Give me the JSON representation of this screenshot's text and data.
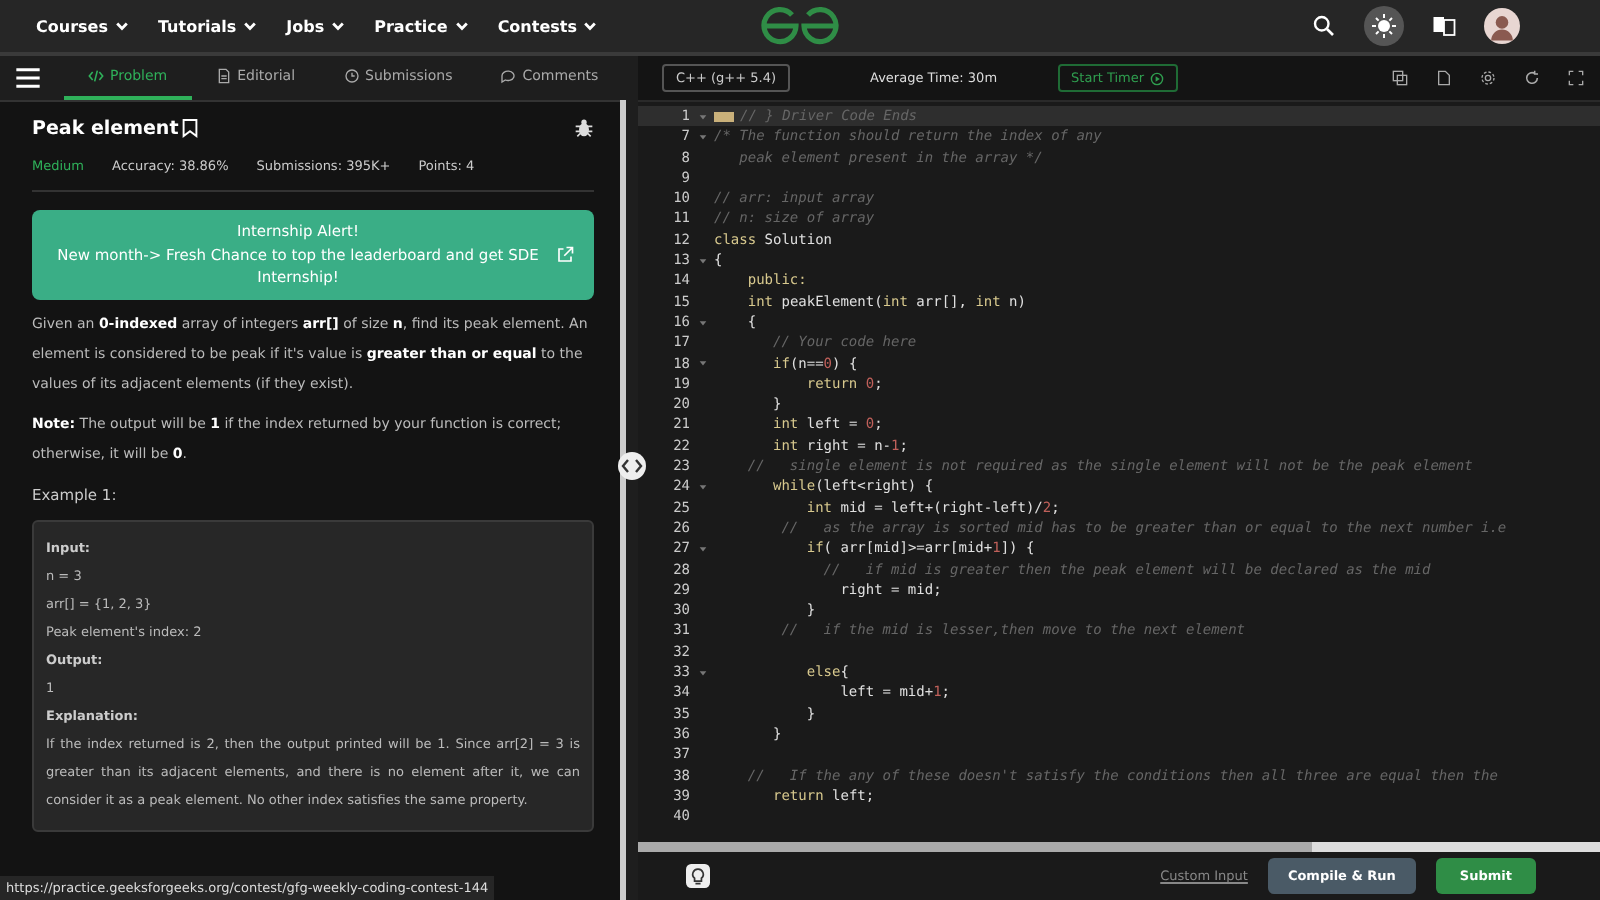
{
  "nav": {
    "menus": [
      "Courses",
      "Tutorials",
      "Jobs",
      "Practice",
      "Contests"
    ]
  },
  "tabs": [
    {
      "label": "Problem",
      "selected": true
    },
    {
      "label": "Editorial",
      "selected": false
    },
    {
      "label": "Submissions",
      "selected": false
    },
    {
      "label": "Comments",
      "selected": false
    }
  ],
  "problem": {
    "title": "Peak element",
    "difficulty": "Medium",
    "accuracy": "Accuracy: 38.86%",
    "submissions": "Submissions: 395K+",
    "points": "Points: 4",
    "alert": [
      "Internship Alert!",
      "New month-> Fresh Chance to top the leaderboard and get SDE Internship!"
    ],
    "description": "Given an **0-indexed** array of integers **arr[]** of size **n**, find its peak element. An element is considered to be peak if it's value is **greater than or equal** to the values of its adjacent elements (if they exist).",
    "note": "**Note:** The output will be **1** if the index returned by your function is correct; otherwise, it will be **0**.",
    "example_title": "Example 1:",
    "example": [
      {
        "kind": "heading",
        "text": "Input:"
      },
      {
        "kind": "text",
        "text": "n = 3"
      },
      {
        "kind": "text",
        "text": "arr[] = {1, 2, 3}"
      },
      {
        "kind": "text",
        "text": "Peak element's index: 2"
      },
      {
        "kind": "heading",
        "text": "Output:"
      },
      {
        "kind": "text",
        "text": "1"
      },
      {
        "kind": "heading",
        "text": "Explanation:"
      },
      {
        "kind": "text",
        "text": "If the index returned is 2, then the output printed will be 1. Since arr[2] = 3 is greater than its adjacent elements, and there is no element after it, we can consider it as a peak element. No other index satisfies the same property."
      }
    ]
  },
  "status_url": "https://practice.geeksforgeeks.org/contest/gfg-weekly-coding-contest-144",
  "toolbar": {
    "language": "C++ (g++ 5.4)",
    "average_time": "Average Time: 30m",
    "timer_button": "Start Timer"
  },
  "editor": {
    "lines": [
      {
        "number": "1",
        "foldable": true,
        "collapsed": true,
        "highlighted": true,
        "tokens": [
          {
            "kind": "comment",
            "text": "// } Driver Code Ends"
          }
        ]
      },
      {
        "number": "7",
        "foldable": true,
        "collapsed": false,
        "highlighted": false,
        "tokens": [
          {
            "kind": "comment",
            "text": "/* The function should return the index of any"
          }
        ]
      },
      {
        "number": "8",
        "foldable": false,
        "collapsed": false,
        "highlighted": false,
        "tokens": [
          {
            "kind": "comment",
            "text": "   peak element present in the array */"
          }
        ]
      },
      {
        "number": "9",
        "foldable": false,
        "collapsed": false,
        "highlighted": false
      },
      {
        "number": "10",
        "foldable": false,
        "collapsed": false,
        "highlighted": false,
        "tokens": [
          {
            "kind": "comment",
            "text": "// arr: input array"
          }
        ]
      },
      {
        "number": "11",
        "foldable": false,
        "collapsed": false,
        "highlighted": false,
        "tokens": [
          {
            "kind": "comment",
            "text": "// n: size of array"
          }
        ]
      },
      {
        "number": "12",
        "foldable": false,
        "collapsed": false,
        "highlighted": false,
        "tokens": [
          {
            "kind": "kw",
            "text": "class"
          },
          {
            "kind": "text",
            "text": " Solution"
          }
        ]
      },
      {
        "number": "13",
        "foldable": true,
        "collapsed": false,
        "highlighted": false,
        "tokens": [
          {
            "kind": "text",
            "text": "{"
          }
        ]
      },
      {
        "number": "14",
        "foldable": false,
        "collapsed": false,
        "highlighted": false,
        "tokens": [
          {
            "kind": "kw",
            "text": "    public:"
          }
        ]
      },
      {
        "number": "15",
        "foldable": false,
        "collapsed": false,
        "highlighted": false,
        "tokens": [
          {
            "kind": "kw",
            "text": "    int"
          },
          {
            "kind": "text",
            "text": " peakElement("
          },
          {
            "kind": "kw",
            "text": "int"
          },
          {
            "kind": "text",
            "text": " arr[], "
          },
          {
            "kind": "kw",
            "text": "int"
          },
          {
            "kind": "text",
            "text": " n)"
          }
        ]
      },
      {
        "number": "16",
        "foldable": true,
        "collapsed": false,
        "highlighted": false,
        "tokens": [
          {
            "kind": "text",
            "text": "    {"
          }
        ]
      },
      {
        "number": "17",
        "foldable": false,
        "collapsed": false,
        "highlighted": false,
        "tokens": [
          {
            "kind": "comment",
            "text": "       // Your code here"
          }
        ]
      },
      {
        "number": "18",
        "foldable": true,
        "collapsed": false,
        "highlighted": false,
        "tokens": [
          {
            "kind": "kw",
            "text": "       if"
          },
          {
            "kind": "text",
            "text": "(n=="
          },
          {
            "kind": "num",
            "text": "0"
          },
          {
            "kind": "text",
            "text": ") {"
          }
        ]
      },
      {
        "number": "19",
        "foldable": false,
        "collapsed": false,
        "highlighted": false,
        "tokens": [
          {
            "kind": "kw",
            "text": "           return"
          },
          {
            "kind": "num",
            "text": " 0"
          },
          {
            "kind": "text",
            "text": ";"
          }
        ]
      },
      {
        "number": "20",
        "foldable": false,
        "collapsed": false,
        "highlighted": false,
        "tokens": [
          {
            "kind": "text",
            "text": "       }"
          }
        ]
      },
      {
        "number": "21",
        "foldable": false,
        "collapsed": false,
        "highlighted": false,
        "tokens": [
          {
            "kind": "kw",
            "text": "       int"
          },
          {
            "kind": "text",
            "text": " left = "
          },
          {
            "kind": "num",
            "text": "0"
          },
          {
            "kind": "text",
            "text": ";"
          }
        ]
      },
      {
        "number": "22",
        "foldable": false,
        "collapsed": false,
        "highlighted": false,
        "tokens": [
          {
            "kind": "kw",
            "text": "       int"
          },
          {
            "kind": "text",
            "text": " right = n-"
          },
          {
            "kind": "num",
            "text": "1"
          },
          {
            "kind": "text",
            "text": ";"
          }
        ]
      },
      {
        "number": "23",
        "foldable": false,
        "collapsed": false,
        "highlighted": false,
        "tokens": [
          {
            "kind": "comment",
            "text": "    //   single element is not required as the single element will not be the peak element"
          }
        ]
      },
      {
        "number": "24",
        "foldable": true,
        "collapsed": false,
        "highlighted": false,
        "tokens": [
          {
            "kind": "kw",
            "text": "       while"
          },
          {
            "kind": "text",
            "text": "(left<right) {"
          }
        ]
      },
      {
        "number": "25",
        "foldable": false,
        "collapsed": false,
        "highlighted": false,
        "tokens": [
          {
            "kind": "kw",
            "text": "           int"
          },
          {
            "kind": "text",
            "text": " mid = left+(right-left)/"
          },
          {
            "kind": "num",
            "text": "2"
          },
          {
            "kind": "text",
            "text": ";"
          }
        ]
      },
      {
        "number": "26",
        "foldable": false,
        "collapsed": false,
        "highlighted": false,
        "tokens": [
          {
            "kind": "comment",
            "text": "        //   as the array is sorted mid has to be greater than or equal to the next number i.e"
          }
        ]
      },
      {
        "number": "27",
        "foldable": true,
        "collapsed": false,
        "highlighted": false,
        "tokens": [
          {
            "kind": "kw",
            "text": "           if"
          },
          {
            "kind": "text",
            "text": "( arr[mid]>=arr[mid+"
          },
          {
            "kind": "num",
            "text": "1"
          },
          {
            "kind": "text",
            "text": "]) {"
          }
        ]
      },
      {
        "number": "28",
        "foldable": false,
        "collapsed": false,
        "highlighted": false,
        "tokens": [
          {
            "kind": "comment",
            "text": "             //   if mid is greater then the peak element will be declared as the mid"
          }
        ]
      },
      {
        "number": "29",
        "foldable": false,
        "collapsed": false,
        "highlighted": false,
        "tokens": [
          {
            "kind": "text",
            "text": "               right = mid;"
          }
        ]
      },
      {
        "number": "30",
        "foldable": false,
        "collapsed": false,
        "highlighted": false,
        "tokens": [
          {
            "kind": "text",
            "text": "           }"
          }
        ]
      },
      {
        "number": "31",
        "foldable": false,
        "collapsed": false,
        "highlighted": false,
        "tokens": [
          {
            "kind": "comment",
            "text": "        //   if the mid is lesser,then move to the next element"
          }
        ]
      },
      {
        "number": "32",
        "foldable": false,
        "collapsed": false,
        "highlighted": false
      },
      {
        "number": "33",
        "foldable": true,
        "collapsed": false,
        "highlighted": false,
        "tokens": [
          {
            "kind": "kw",
            "text": "           else"
          },
          {
            "kind": "text",
            "text": "{"
          }
        ]
      },
      {
        "number": "34",
        "foldable": false,
        "collapsed": false,
        "highlighted": false,
        "tokens": [
          {
            "kind": "text",
            "text": "               left = mid+"
          },
          {
            "kind": "num",
            "text": "1"
          },
          {
            "kind": "text",
            "text": ";"
          }
        ]
      },
      {
        "number": "35",
        "foldable": false,
        "collapsed": false,
        "highlighted": false,
        "tokens": [
          {
            "kind": "text",
            "text": "           }"
          }
        ]
      },
      {
        "number": "36",
        "foldable": false,
        "collapsed": false,
        "highlighted": false,
        "tokens": [
          {
            "kind": "text",
            "text": "       }"
          }
        ]
      },
      {
        "number": "37",
        "foldable": false,
        "collapsed": false,
        "highlighted": false
      },
      {
        "number": "38",
        "foldable": false,
        "collapsed": false,
        "highlighted": false,
        "tokens": [
          {
            "kind": "comment",
            "text": "    //   If the any of these doesn't satisfy the conditions then all three are equal then the"
          }
        ]
      },
      {
        "number": "39",
        "foldable": false,
        "collapsed": false,
        "highlighted": false,
        "tokens": [
          {
            "kind": "kw",
            "text": "       return"
          },
          {
            "kind": "text",
            "text": " left;"
          }
        ]
      },
      {
        "number": "40",
        "foldable": false,
        "collapsed": false,
        "highlighted": false
      }
    ]
  },
  "footer": {
    "custom_input": "Custom Input",
    "compile_button": "Compile & Run",
    "submit_button": "Submit"
  }
}
